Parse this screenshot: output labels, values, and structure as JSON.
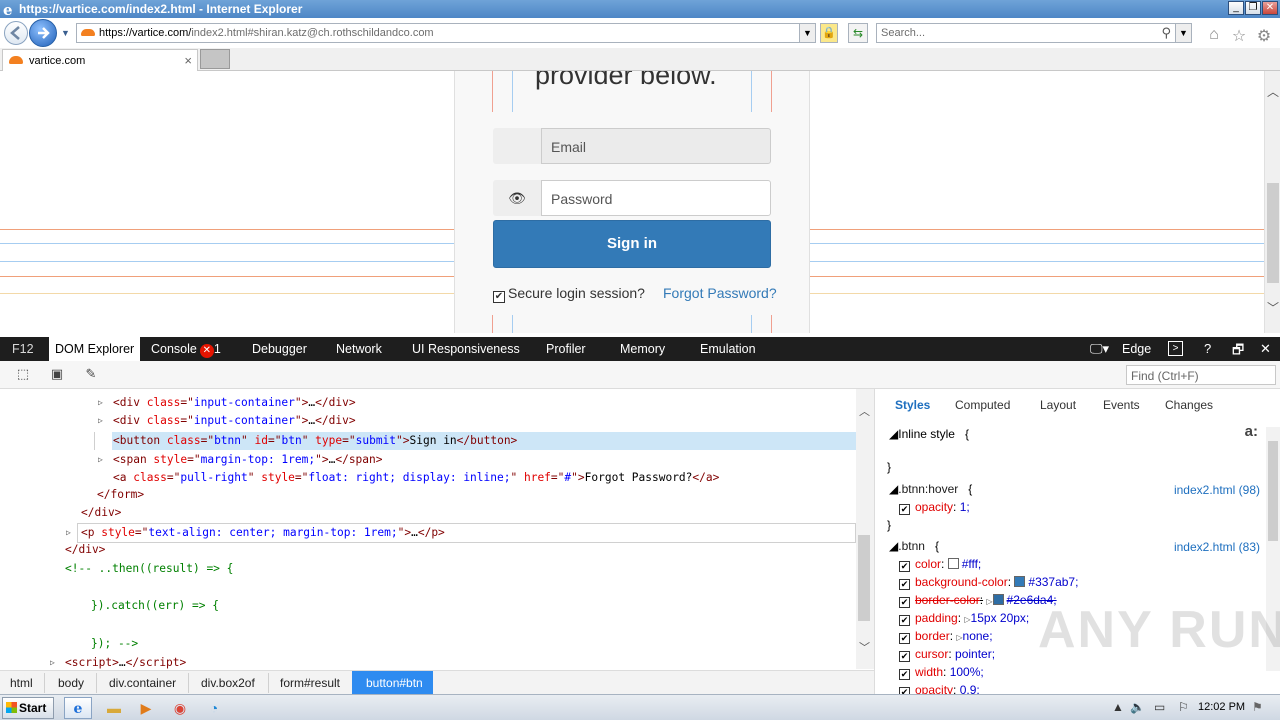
{
  "window": {
    "title": "https://vartice.com/index2.html - Internet Explorer",
    "controls": [
      "_",
      "❐",
      "✕"
    ]
  },
  "addressbar": {
    "url_host": "https://vartice.com/",
    "url_rest": "index2.html#shiran.katz@ch.rothschildandco.com",
    "search_placeholder": "Search..."
  },
  "tabs": [
    {
      "label": "vartice.com",
      "close": "×"
    }
  ],
  "page": {
    "heading": "provider below.",
    "email_placeholder": "Email",
    "password_placeholder": "Password",
    "eye_glyph": "👁",
    "signin_label": "Sign in",
    "secure_label": "Secure login session?",
    "forgot_label": "Forgot Password?"
  },
  "devtools": {
    "tabs": {
      "f12": "F12",
      "dom": "DOM Explorer",
      "console": "Console",
      "console_errors": "1",
      "debugger": "Debugger",
      "network": "Network",
      "ui": "UI Responsiveness",
      "profiler": "Profiler",
      "memory": "Memory",
      "emulation": "Emulation",
      "mode": "Edge"
    },
    "find_placeholder": "Find (Ctrl+F)",
    "breadcrumbs": [
      "html",
      "body",
      "div.container",
      "div.box2of",
      "form#result",
      "button#btn"
    ],
    "style_tabs": [
      "Styles",
      "Computed",
      "Layout",
      "Events",
      "Changes"
    ],
    "styles": {
      "inline_label": "Inline style",
      "hover_selector": ".btnn:hover",
      "hover_source": "index2.html (98)",
      "hover_prop": "opacity",
      "hover_val": "1;",
      "btnn_selector": ".btnn",
      "btnn_source": "index2.html (83)",
      "props": [
        {
          "name": "color",
          "value": "#fff;"
        },
        {
          "name": "background-color",
          "value": "#337ab7;"
        },
        {
          "name": "border-color",
          "value": "#2e6da4;"
        },
        {
          "name": "padding",
          "value": "15px 20px;"
        },
        {
          "name": "border",
          "value": "none;"
        },
        {
          "name": "cursor",
          "value": "pointer;"
        },
        {
          "name": "width",
          "value": "100%;"
        },
        {
          "name": "opacity",
          "value": "0.9;"
        }
      ],
      "aa_label": "a:"
    }
  },
  "taskbar": {
    "start": "Start",
    "time": "12:02 PM"
  },
  "watermark": "ANY RUN",
  "colors": {
    "btn_primary": "#337ab7",
    "btn_border": "#2e6da4",
    "selected_crumb": "#2e8bf0",
    "devtools_bar": "#1e1e1e"
  }
}
